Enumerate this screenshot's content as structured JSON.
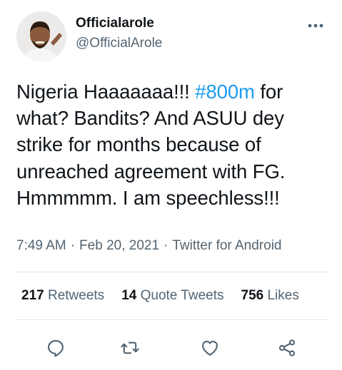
{
  "tweet": {
    "display_name": "Officialarole",
    "handle": "@OfficialArole",
    "text_before_hashtag": "Nigeria Haaaaaaa!!! ",
    "hashtag": "#800m",
    "text_after_hashtag": " for what? Bandits? And ASUU dey strike for months because of unreached agreement with FG. Hmmmmm. I am speechless!!!",
    "time": "7:49 AM",
    "date": "Feb 20, 2021",
    "source": "Twitter for Android",
    "separator": "·"
  },
  "stats": {
    "retweets_count": "217",
    "retweets_label": "Retweets",
    "quote_tweets_count": "14",
    "quote_tweets_label": "Quote Tweets",
    "likes_count": "756",
    "likes_label": "Likes"
  },
  "icons": {
    "more": "more-options-icon",
    "reply": "reply-icon",
    "retweet": "retweet-icon",
    "like": "like-icon",
    "share": "share-icon"
  },
  "colors": {
    "link": "#1d9bf0",
    "secondary_text": "#536471",
    "primary_text": "#0f1419",
    "divider": "#e1e5e8"
  }
}
